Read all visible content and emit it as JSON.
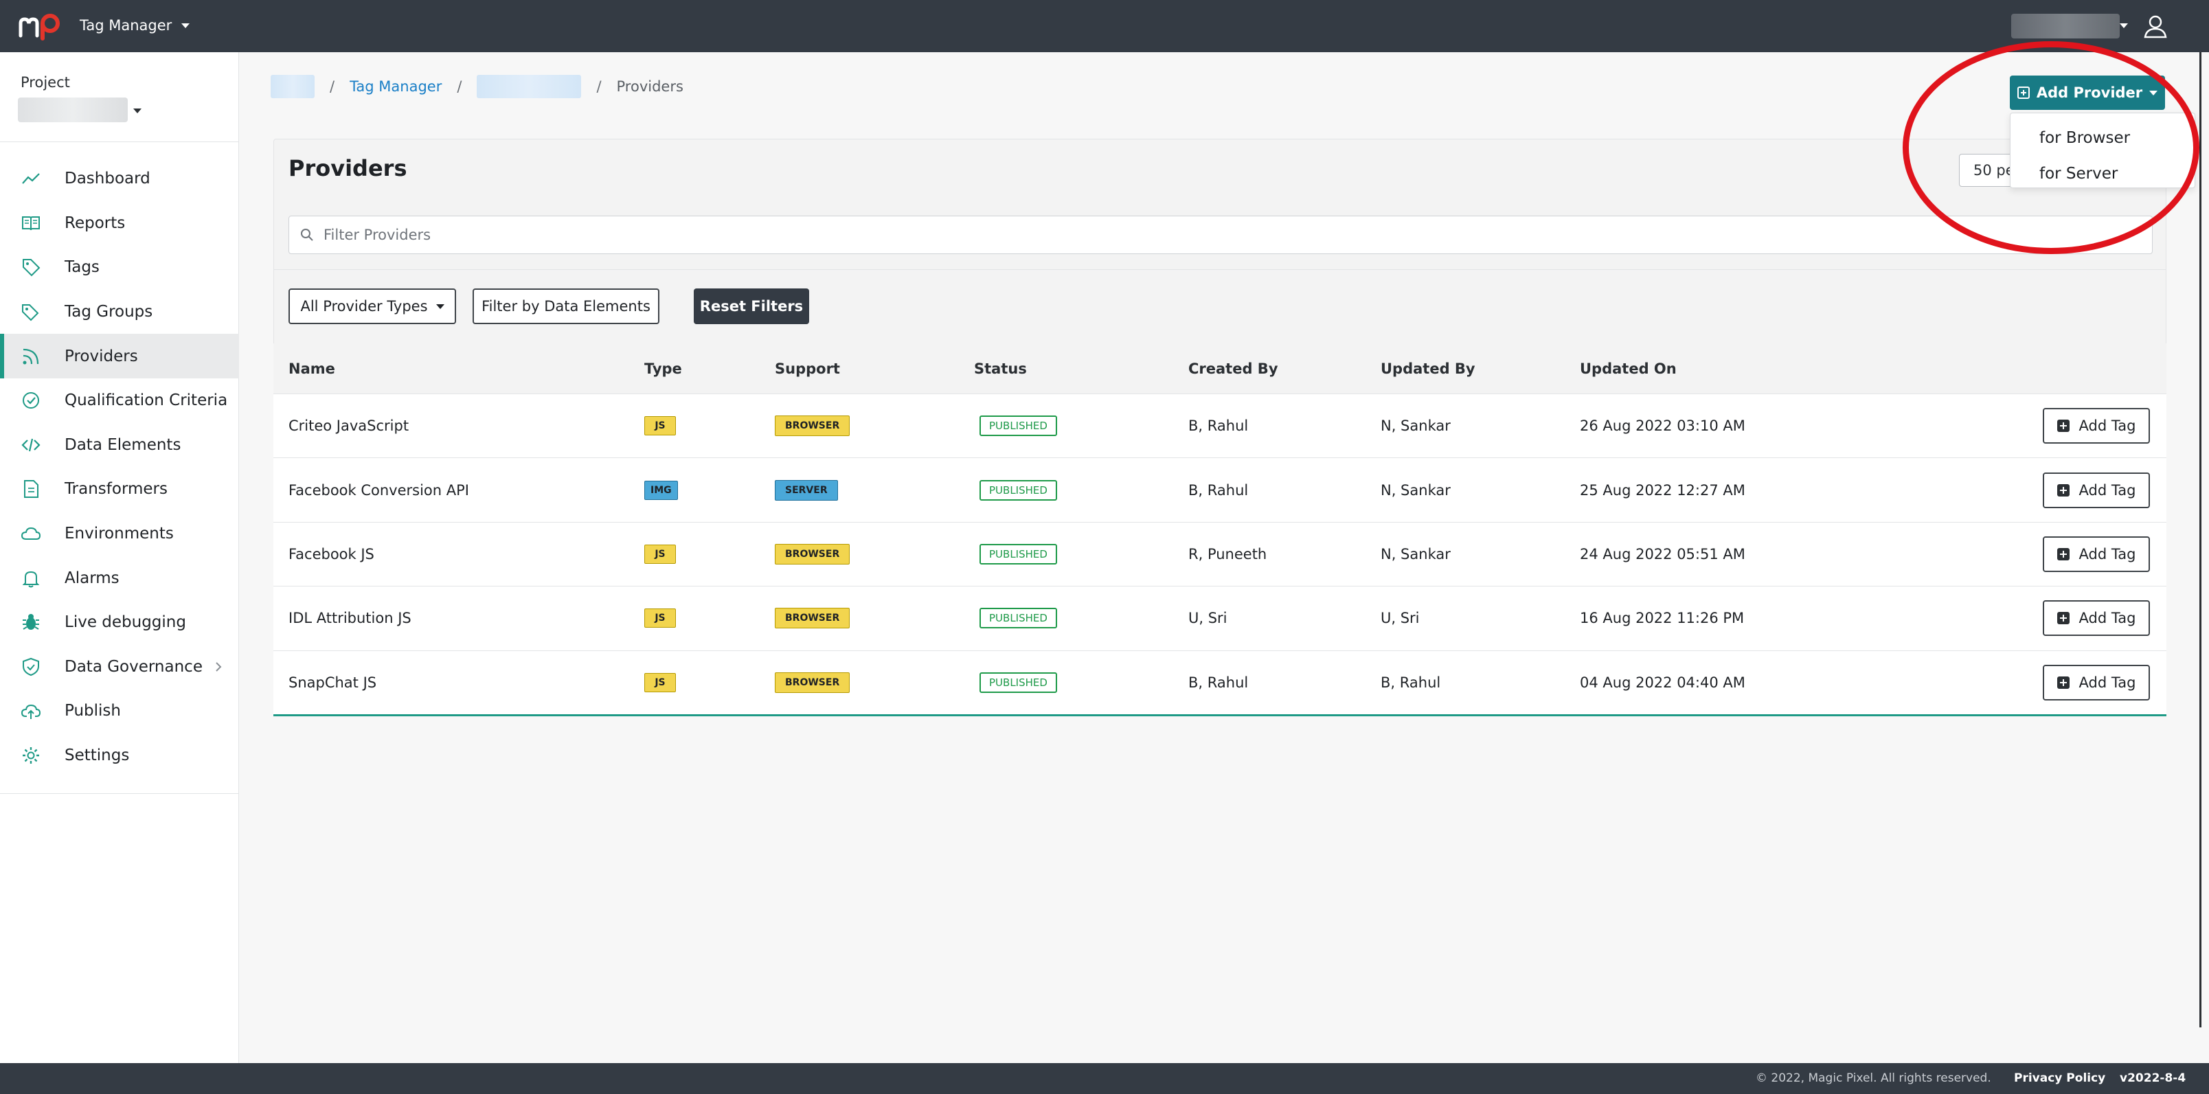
{
  "header": {
    "app_name": "Tag Manager"
  },
  "project": {
    "label": "Project"
  },
  "sidebar": {
    "items": [
      {
        "label": "Dashboard",
        "icon": "trend-line-icon"
      },
      {
        "label": "Reports",
        "icon": "book-icon"
      },
      {
        "label": "Tags",
        "icon": "tag-icon"
      },
      {
        "label": "Tag Groups",
        "icon": "tags-icon"
      },
      {
        "label": "Providers",
        "icon": "rss-icon",
        "active": true
      },
      {
        "label": "Qualification Criteria",
        "icon": "check-circle-icon"
      },
      {
        "label": "Data Elements",
        "icon": "code-icon"
      },
      {
        "label": "Transformers",
        "icon": "file-transform-icon"
      },
      {
        "label": "Environments",
        "icon": "cloud-icon"
      },
      {
        "label": "Alarms",
        "icon": "bell-icon"
      },
      {
        "label": "Live debugging",
        "icon": "bug-icon"
      },
      {
        "label": "Data Governance",
        "icon": "shield-icon"
      },
      {
        "label": "Publish",
        "icon": "cloud-upload-icon"
      },
      {
        "label": "Settings",
        "icon": "gear-icon"
      }
    ]
  },
  "breadcrumb": {
    "link": "Tag Manager",
    "current": "Providers"
  },
  "add_provider": {
    "label": "Add Provider",
    "options": [
      "for Browser",
      "for Server"
    ]
  },
  "page": {
    "title": "Providers",
    "per_page": "50 pe"
  },
  "filter": {
    "placeholder": "Filter Providers"
  },
  "filters": {
    "provider_types": "All Provider Types",
    "data_elements": "Filter by Data Elements",
    "reset": "Reset Filters"
  },
  "table": {
    "columns": [
      "Name",
      "Type",
      "Support",
      "Status",
      "Created By",
      "Updated By",
      "Updated On"
    ],
    "rows": [
      {
        "name": "Criteo JavaScript",
        "type": "JS",
        "support": "BROWSER",
        "status": "PUBLISHED",
        "created_by": "B, Rahul",
        "updated_by": "N, Sankar",
        "updated_on": "26 Aug 2022 03:10 AM",
        "action": "Add Tag"
      },
      {
        "name": "Facebook Conversion API",
        "type": "IMG",
        "support": "SERVER",
        "status": "PUBLISHED",
        "created_by": "B, Rahul",
        "updated_by": "N, Sankar",
        "updated_on": "25 Aug 2022 12:27 AM",
        "action": "Add Tag"
      },
      {
        "name": "Facebook JS",
        "type": "JS",
        "support": "BROWSER",
        "status": "PUBLISHED",
        "created_by": "R, Puneeth",
        "updated_by": "N, Sankar",
        "updated_on": "24 Aug 2022 05:51 AM",
        "action": "Add Tag"
      },
      {
        "name": "IDL Attribution JS",
        "type": "JS",
        "support": "BROWSER",
        "status": "PUBLISHED",
        "created_by": "U, Sri",
        "updated_by": "U, Sri",
        "updated_on": "16 Aug 2022 11:26 PM",
        "action": "Add Tag"
      },
      {
        "name": "SnapChat JS",
        "type": "JS",
        "support": "BROWSER",
        "status": "PUBLISHED",
        "created_by": "B, Rahul",
        "updated_by": "B, Rahul",
        "updated_on": "04 Aug 2022 04:40 AM",
        "action": "Add Tag"
      }
    ]
  },
  "footer": {
    "copyright": "© 2022, Magic Pixel. All rights reserved.",
    "privacy": "Privacy Policy",
    "version": "v2022-8-4"
  },
  "colors": {
    "topbar": "#343b44",
    "accent": "#1e9a86",
    "primary_button": "#187b85",
    "link": "#1a7fc7",
    "badge_js": "#f2d54e",
    "badge_img": "#4aa8d8",
    "badge_browser": "#f2d54e",
    "badge_server": "#4aa8d8",
    "published": "#1e9a49",
    "highlight_circle": "#e0141c"
  }
}
